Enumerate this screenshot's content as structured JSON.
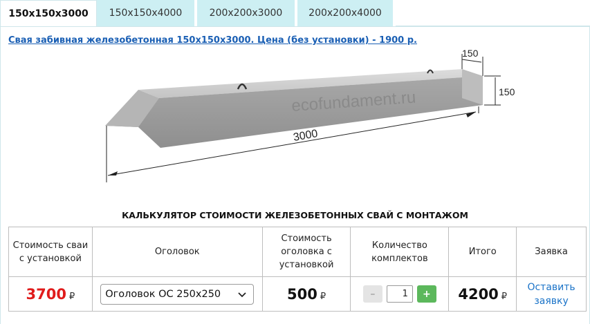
{
  "tabs": [
    {
      "label": "150x150x3000",
      "active": true
    },
    {
      "label": "150x150x4000",
      "active": false
    },
    {
      "label": "200x200x3000",
      "active": false
    },
    {
      "label": "200x200x4000",
      "active": false
    }
  ],
  "product": {
    "link_text": "Свая забивная железобетонная 150х150х3000. Цена (без установки) - 1900 р."
  },
  "drawing": {
    "watermark": "ecofundament.ru",
    "length_label": "3000",
    "width_label": "150",
    "height_label": "150"
  },
  "calculator": {
    "title": "КАЛЬКУЛЯТОР СТОИМОСТИ ЖЕЛЕЗОБЕТОННЫХ СВАЙ С МОНТАЖОМ",
    "headers": {
      "pile_cost": "Стоимость сваи с установкой",
      "cap": "Оголовок",
      "cap_cost": "Стоимость оголовка с установкой",
      "quantity": "Количество комплектов",
      "total": "Итого",
      "order": "Заявка"
    },
    "row": {
      "pile_cost": "3700",
      "currency": "₽",
      "cap_selected": "Оголовок ОС 250х250",
      "cap_cost": "500",
      "minus": "–",
      "quantity": "1",
      "plus": "+",
      "total": "4200",
      "order_link": "Оставить заявку"
    }
  },
  "colors": {
    "tab_inactive": "#cdeff3",
    "link": "#1a5fb4",
    "price_red": "#e01b1b",
    "plus_button": "#5cb85c"
  }
}
